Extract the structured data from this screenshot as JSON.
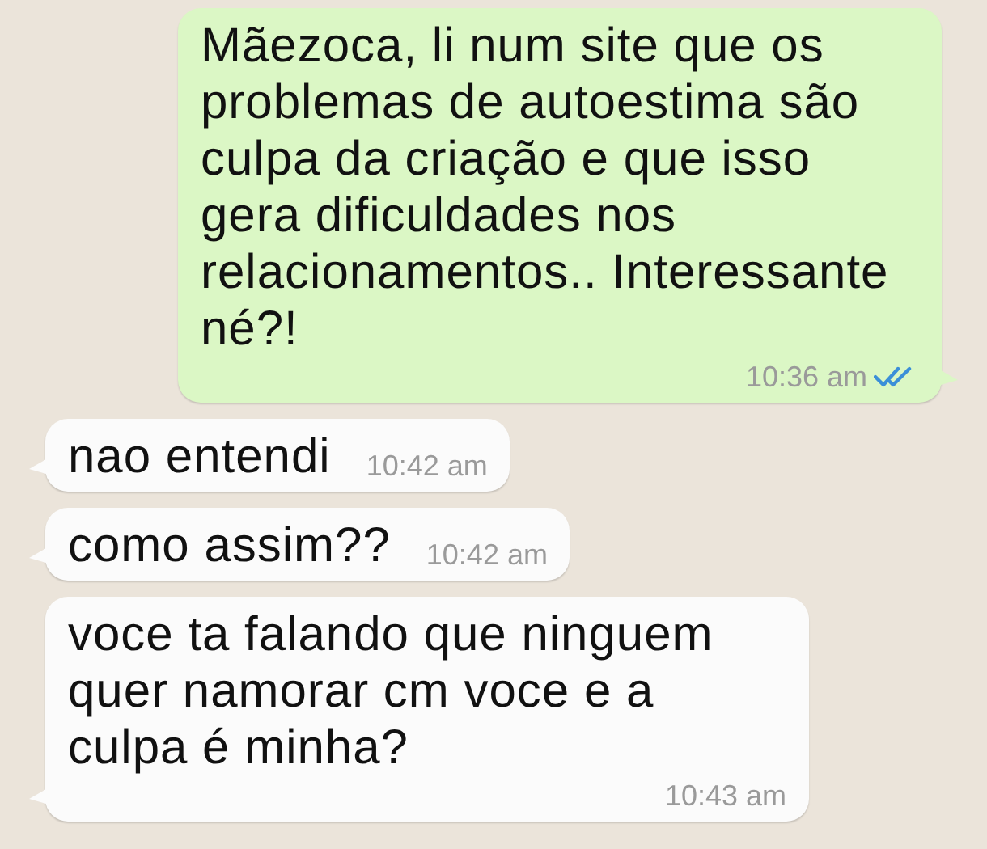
{
  "messages": [
    {
      "kind": "sent",
      "text": "Mãezoca, li num site que os problemas de autoestima são culpa da criação e que isso gera dificuldades nos relacionamentos.. Interessante né?!",
      "time": "10:36 am",
      "read": true
    },
    {
      "kind": "received",
      "text": "nao entendi",
      "time": "10:42 am"
    },
    {
      "kind": "received",
      "text": "como assim??",
      "time": "10:42 am"
    },
    {
      "kind": "received",
      "text": "voce ta falando que ninguem quer namorar cm voce e a culpa é minha?",
      "time": "10:43 am"
    }
  ]
}
